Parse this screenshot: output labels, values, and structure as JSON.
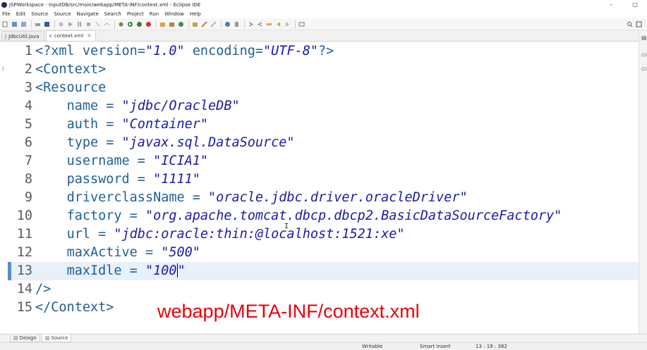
{
  "window": {
    "title": "JSPWorkspace - InputDB/src/main/webapp/META-INF/context.xml - Eclipse IDE",
    "controls": [
      "–",
      "□"
    ]
  },
  "menu": [
    "File",
    "Edit",
    "Source",
    "Source",
    "Navigate",
    "Search",
    "Project",
    "Run",
    "Window",
    "Help"
  ],
  "tabs": [
    {
      "label": "JdbcUtil.java",
      "icon": "java-file-icon",
      "active": false
    },
    {
      "label": "context.xml",
      "icon": "xml-file-icon",
      "active": true
    }
  ],
  "editor": {
    "current_line": 13,
    "lines": [
      {
        "num": "1",
        "indent": "",
        "parts": [
          {
            "t": "<?xml version=",
            "c": "text"
          },
          {
            "t": "\"1.0\"",
            "c": "q"
          },
          {
            "t": " encoding=",
            "c": "text"
          },
          {
            "t": "\"UTF-8\"",
            "c": "q"
          },
          {
            "t": "?>",
            "c": "text"
          }
        ]
      },
      {
        "num": "2",
        "indent": "",
        "parts": [
          {
            "t": "<Context>",
            "c": "text"
          }
        ]
      },
      {
        "num": "3",
        "indent": "",
        "parts": [
          {
            "t": "<Resource",
            "c": "text"
          }
        ]
      },
      {
        "num": "4",
        "indent": "    ",
        "parts": [
          {
            "t": "name = ",
            "c": "text"
          },
          {
            "t": "\"jdbc/OracleDB\"",
            "c": "q"
          }
        ]
      },
      {
        "num": "5",
        "indent": "    ",
        "parts": [
          {
            "t": "auth = ",
            "c": "text"
          },
          {
            "t": "\"Container\"",
            "c": "q"
          }
        ]
      },
      {
        "num": "6",
        "indent": "    ",
        "parts": [
          {
            "t": "type = ",
            "c": "text"
          },
          {
            "t": "\"javax.sql.DataSource\"",
            "c": "q"
          }
        ]
      },
      {
        "num": "7",
        "indent": "    ",
        "parts": [
          {
            "t": "username = ",
            "c": "text"
          },
          {
            "t": "\"ICIA1\"",
            "c": "q"
          }
        ]
      },
      {
        "num": "8",
        "indent": "    ",
        "parts": [
          {
            "t": "password = ",
            "c": "text"
          },
          {
            "t": "\"1111\"",
            "c": "q"
          }
        ]
      },
      {
        "num": "9",
        "indent": "    ",
        "parts": [
          {
            "t": "driverclassName = ",
            "c": "text"
          },
          {
            "t": "\"oracle.jdbc.driver.oracleDriver\"",
            "c": "q"
          }
        ]
      },
      {
        "num": "10",
        "indent": "    ",
        "parts": [
          {
            "t": "factory = ",
            "c": "text"
          },
          {
            "t": "\"org.apache.tomcat.dbcp.dbcp2.BasicDataSourceFactory\"",
            "c": "q"
          }
        ]
      },
      {
        "num": "11",
        "indent": "    ",
        "parts": [
          {
            "t": "url = ",
            "c": "text"
          },
          {
            "t": "\"jdbc:oracle:thin:@localhost:1521:xe\"",
            "c": "q"
          }
        ]
      },
      {
        "num": "12",
        "indent": "    ",
        "parts": [
          {
            "t": "maxActive = ",
            "c": "text"
          },
          {
            "t": "\"500\"",
            "c": "q"
          }
        ]
      },
      {
        "num": "13",
        "indent": "    ",
        "parts": [
          {
            "t": "maxIdle = ",
            "c": "text"
          },
          {
            "t": "\"100",
            "c": "q"
          },
          {
            "t": "|caret|",
            "c": "caret"
          },
          {
            "t": "\"",
            "c": "q"
          }
        ]
      },
      {
        "num": "14",
        "indent": "",
        "parts": [
          {
            "t": "/>",
            "c": "text"
          }
        ]
      },
      {
        "num": "15",
        "indent": "",
        "parts": [
          {
            "t": "</Context>",
            "c": "text"
          }
        ]
      }
    ]
  },
  "overlay_label": "webapp/META-INF/context.xml",
  "bottom_tabs": [
    {
      "label": "Design",
      "active": false
    },
    {
      "label": "Source",
      "active": true
    }
  ],
  "status": {
    "writable": "Writable",
    "insert_mode": "Smart Insert",
    "position": "13 : 19 : 382"
  },
  "colors": {
    "code_text": "#1f5f96",
    "code_string": "#1a1aa6",
    "overlay_red": "#e8000a",
    "current_line_bg": "#e8f0fc"
  }
}
